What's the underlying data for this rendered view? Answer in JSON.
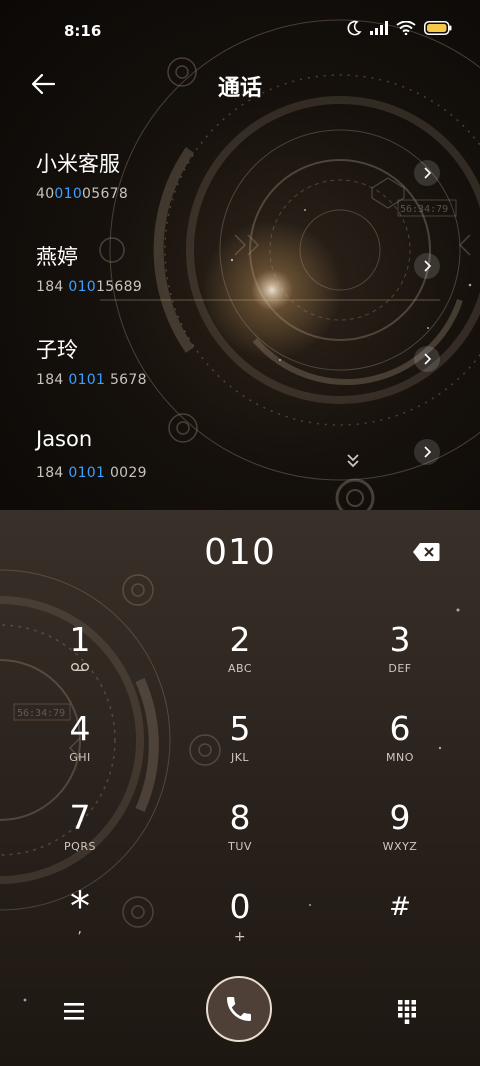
{
  "status": {
    "time": "8:16"
  },
  "header": {
    "title": "通话"
  },
  "contacts": [
    {
      "name": "小米客服",
      "number_pre": "40",
      "number_hl": "010",
      "number_post": "05678"
    },
    {
      "name": "燕婷",
      "number_pre": "184 ",
      "number_hl": "010",
      "number_post": "15689"
    },
    {
      "name": "子玲",
      "number_pre": "184 ",
      "number_hl": "0101",
      "number_post": " 5678"
    },
    {
      "name": "Jason",
      "number_pre": "184 ",
      "number_hl": "0101",
      "number_post": " 0029"
    }
  ],
  "dialer": {
    "input": "010",
    "keys": [
      {
        "digit": "1",
        "letters": ""
      },
      {
        "digit": "2",
        "letters": "ABC"
      },
      {
        "digit": "3",
        "letters": "DEF"
      },
      {
        "digit": "4",
        "letters": "GHI"
      },
      {
        "digit": "5",
        "letters": "JKL"
      },
      {
        "digit": "6",
        "letters": "MNO"
      },
      {
        "digit": "7",
        "letters": "PQRS"
      },
      {
        "digit": "8",
        "letters": "TUV"
      },
      {
        "digit": "9",
        "letters": "WXYZ"
      },
      {
        "digit": "*",
        "letters": ","
      },
      {
        "digit": "0",
        "letters": "+"
      },
      {
        "digit": "#",
        "letters": ""
      }
    ]
  },
  "theme": {
    "highlight": "#3aa0ff",
    "call_ring": "#e8dccd",
    "call_fill": "#4e4037"
  },
  "icons": {
    "back": "arrow-left-icon",
    "backspace": "backspace-icon",
    "menu": "menu-icon",
    "call": "phone-icon",
    "keypad": "dialpad-icon",
    "voicemail": "voicemail-icon"
  }
}
